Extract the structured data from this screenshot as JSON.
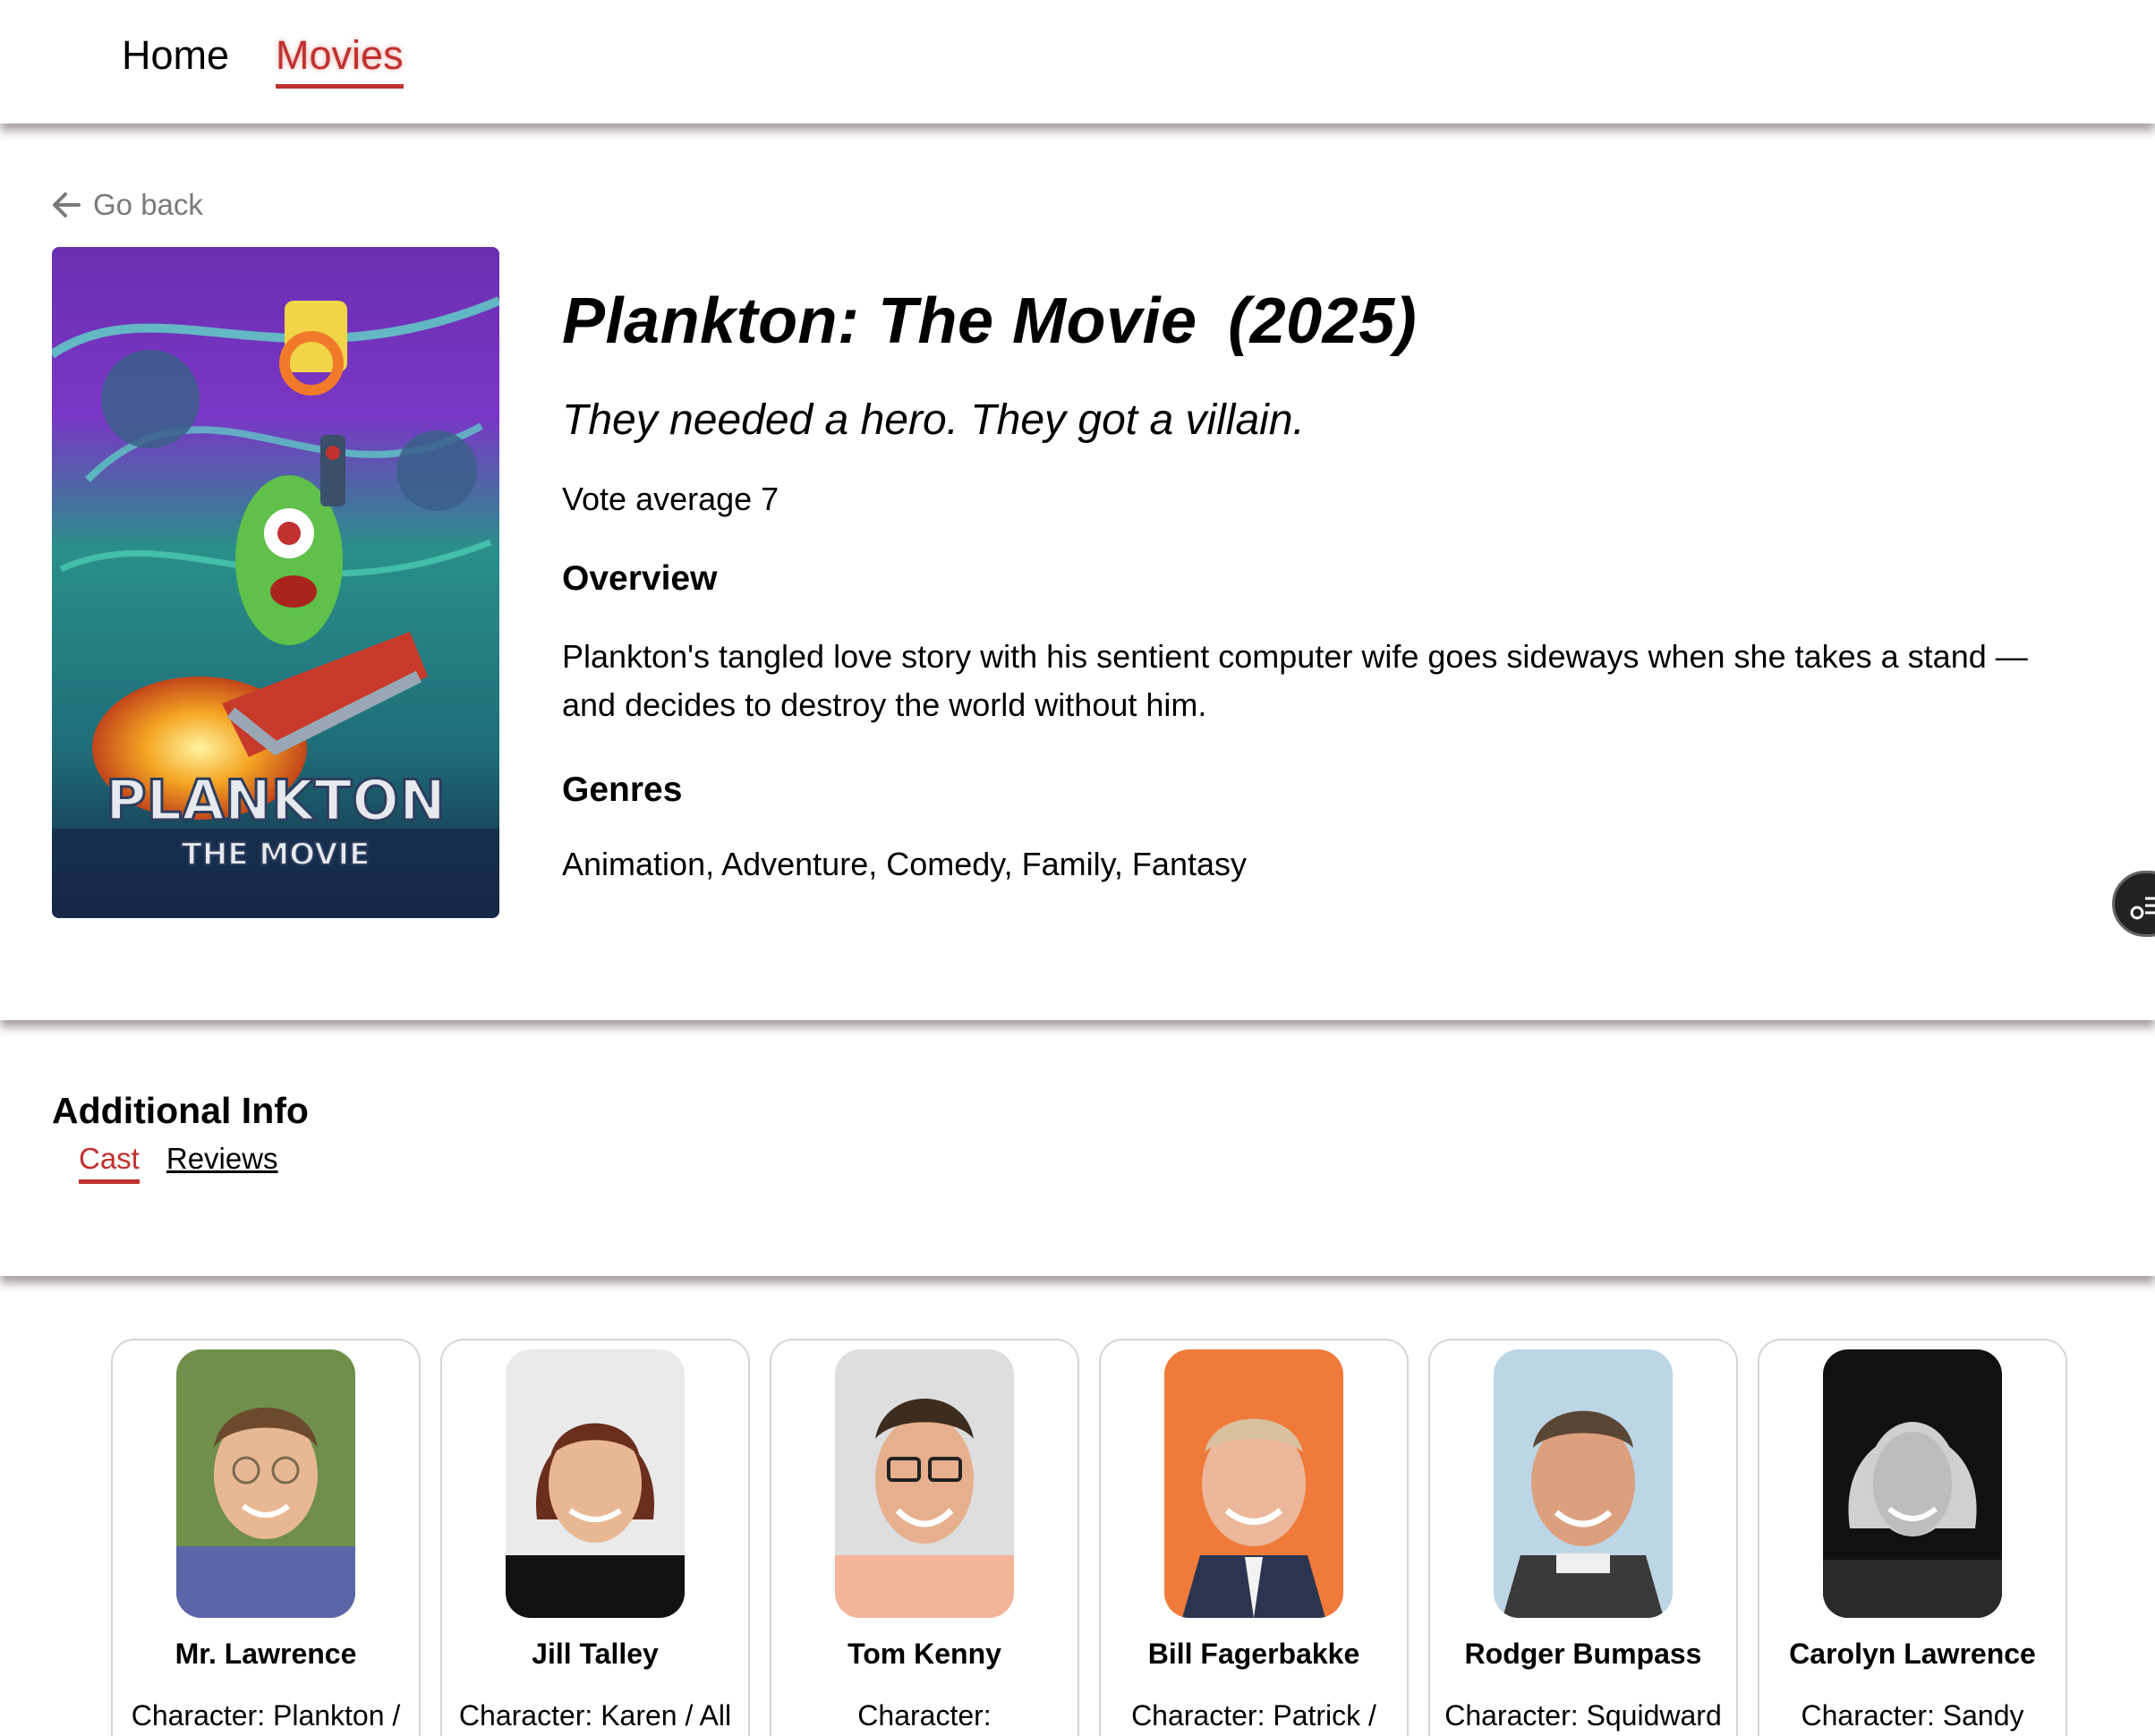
{
  "nav": {
    "home": "Home",
    "movies": "Movies"
  },
  "go_back": {
    "label": "Go back",
    "icon": "arrow-left-icon"
  },
  "movie": {
    "title": "Plankton: The Movie",
    "year": "(2025)",
    "tagline": "They needed a hero. They got a villain.",
    "vote_label": "Vote average 7",
    "overview_heading": "Overview",
    "overview": "Plankton's tangled love story with his sentient computer wife goes sideways when she takes a stand — and decides to destroy the world without him.",
    "genres_heading": "Genres",
    "genres": "Animation, Adventure, Comedy, Family, Fantasy",
    "poster": {
      "logo_line1": "PLANKTON",
      "logo_line2": "THE MOVIE"
    }
  },
  "additional": {
    "title": "Additional Info",
    "tabs": {
      "cast": "Cast",
      "reviews": "Reviews"
    }
  },
  "cast": [
    {
      "name": "Mr. Lawrence",
      "character": "Character: Plankton /"
    },
    {
      "name": "Jill Talley",
      "character": "Character: Karen / All"
    },
    {
      "name": "Tom Kenny",
      "character": "Character:"
    },
    {
      "name": "Bill Fagerbakke",
      "character": "Character: Patrick /"
    },
    {
      "name": "Rodger Bumpass",
      "character": "Character: Squidward"
    },
    {
      "name": "Carolyn Lawrence",
      "character": "Character: Sandy"
    }
  ],
  "colors": {
    "accent": "#c0312f",
    "muted": "#7a7a7a"
  }
}
